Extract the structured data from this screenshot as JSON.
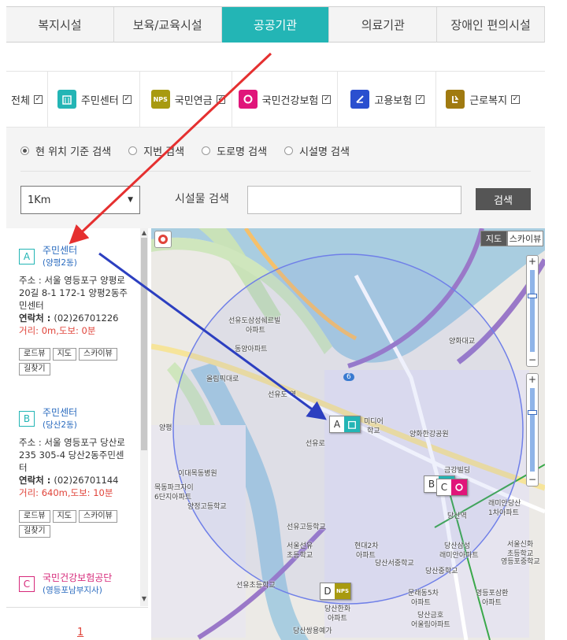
{
  "tabs": [
    {
      "label": "복지시설"
    },
    {
      "label": "보육/교육시설"
    },
    {
      "label": "공공기관",
      "active": true
    },
    {
      "label": "의료기관"
    },
    {
      "label": "장애인 편의시설"
    }
  ],
  "categories": [
    {
      "label": "전체",
      "icon": null,
      "checked": true
    },
    {
      "label": "주민센터",
      "icon": "building-icon",
      "color": "#23b5b5",
      "checked": true
    },
    {
      "label": "국민연금",
      "icon": "nps-icon",
      "color": "#a89a10",
      "checked": true
    },
    {
      "label": "국민건강보험",
      "icon": "health-icon",
      "color": "#e0157a",
      "checked": true
    },
    {
      "label": "고용보험",
      "icon": "employment-icon",
      "color": "#2a4fcf",
      "checked": true
    },
    {
      "label": "근로복지",
      "icon": "welfare-icon",
      "color": "#a07a10",
      "checked": true
    }
  ],
  "search": {
    "modes": [
      {
        "label": "현 위치 기준 검색",
        "selected": true
      },
      {
        "label": "지번 검색",
        "selected": false
      },
      {
        "label": "도로명 검색",
        "selected": false
      },
      {
        "label": "시설명 검색",
        "selected": false
      }
    ],
    "radius": "1Km",
    "label": "시설물 검색",
    "input_value": "",
    "button": "검색"
  },
  "results": [
    {
      "badge": "A",
      "name": "주민센터",
      "sub": "(양평2동)",
      "address_label": "주소 : ",
      "address": "서울 영등포구 양평로20길 8-1 172-1 양평2동주민센터",
      "phone_label": "연락처 : ",
      "phone": "(02)26701226",
      "distance": "거리: 0m,도보: 0분",
      "buttons": [
        "로드뷰",
        "지도",
        "스카이뷰",
        "길찾기"
      ]
    },
    {
      "badge": "B",
      "name": "주민센터",
      "sub": "(당산2동)",
      "address_label": "주소 : ",
      "address": "서울 영등포구 당산로 235 305-4 당산2동주민센터",
      "phone_label": "연락처 : ",
      "phone": "(02)26701144",
      "distance": "거리: 640m,도보: 10분",
      "buttons": [
        "로드뷰",
        "지도",
        "스카이뷰",
        "길찾기"
      ]
    },
    {
      "badge": "C",
      "name": "국민건강보험공단",
      "sub": "(영등포남부지사)"
    }
  ],
  "pagination": {
    "current": "1"
  },
  "map": {
    "type_buttons": [
      "지도",
      "스카이뷰"
    ],
    "labels": {
      "l1": "선유도삼성쉐르빌",
      "l1b": "아파트",
      "l2": "동양아파트",
      "l3": "선유도 역",
      "l4": "양평",
      "l5": "이대목동병원",
      "l6": "목동파크자이",
      "l6b": "6단지아파트",
      "l7": "양정고등학교",
      "l8": "선유고등학교",
      "l9": "서울선유",
      "l9b": "초등학교",
      "l10": "현대2차",
      "l10b": "아파트",
      "l11": "당산서중학교",
      "l12": "양화한강공원",
      "l13": "금강빌딩",
      "l14": "당산역",
      "l15": "래미안당산",
      "l15b": "1차아파트",
      "l16": "당산삼성",
      "l16b": "래미안아파트",
      "l17": "서울신화",
      "l17b": "초등학교",
      "l18": "영등포중학교",
      "l19": "당산중학교",
      "l20": "양화대교",
      "l21": "당산쌍용예가",
      "l22": "영등포삼환",
      "l22b": "아파트",
      "l23": "문래동5차",
      "l23b": "아파트",
      "l24": "당산금호",
      "l24b": "어울림아파트",
      "l25": "선유초등학교",
      "l26": "선유로",
      "l27": "올림픽대로",
      "l28": "미디어",
      "l28b": "학교",
      "l29": "당산한화",
      "l29b": "아파트",
      "route": "6"
    },
    "markers": [
      {
        "letter": "A",
        "icon": "building-icon",
        "color": "#23b5b5"
      },
      {
        "letter": "B",
        "icon": "building-icon",
        "color": "#23b5b5"
      },
      {
        "letter": "C",
        "icon": "health-icon",
        "color": "#e0157a"
      },
      {
        "letter": "D",
        "icon": "nps-icon",
        "color": "#a89a10"
      }
    ],
    "zoom": {
      "plus": "+",
      "minus": "−"
    }
  },
  "colors": {
    "accent": "#23b5b5",
    "link": "#2a6bbf",
    "distance": "#e0443a",
    "red_arrow": "#e53030",
    "blue_arrow": "#2c3fc0"
  }
}
